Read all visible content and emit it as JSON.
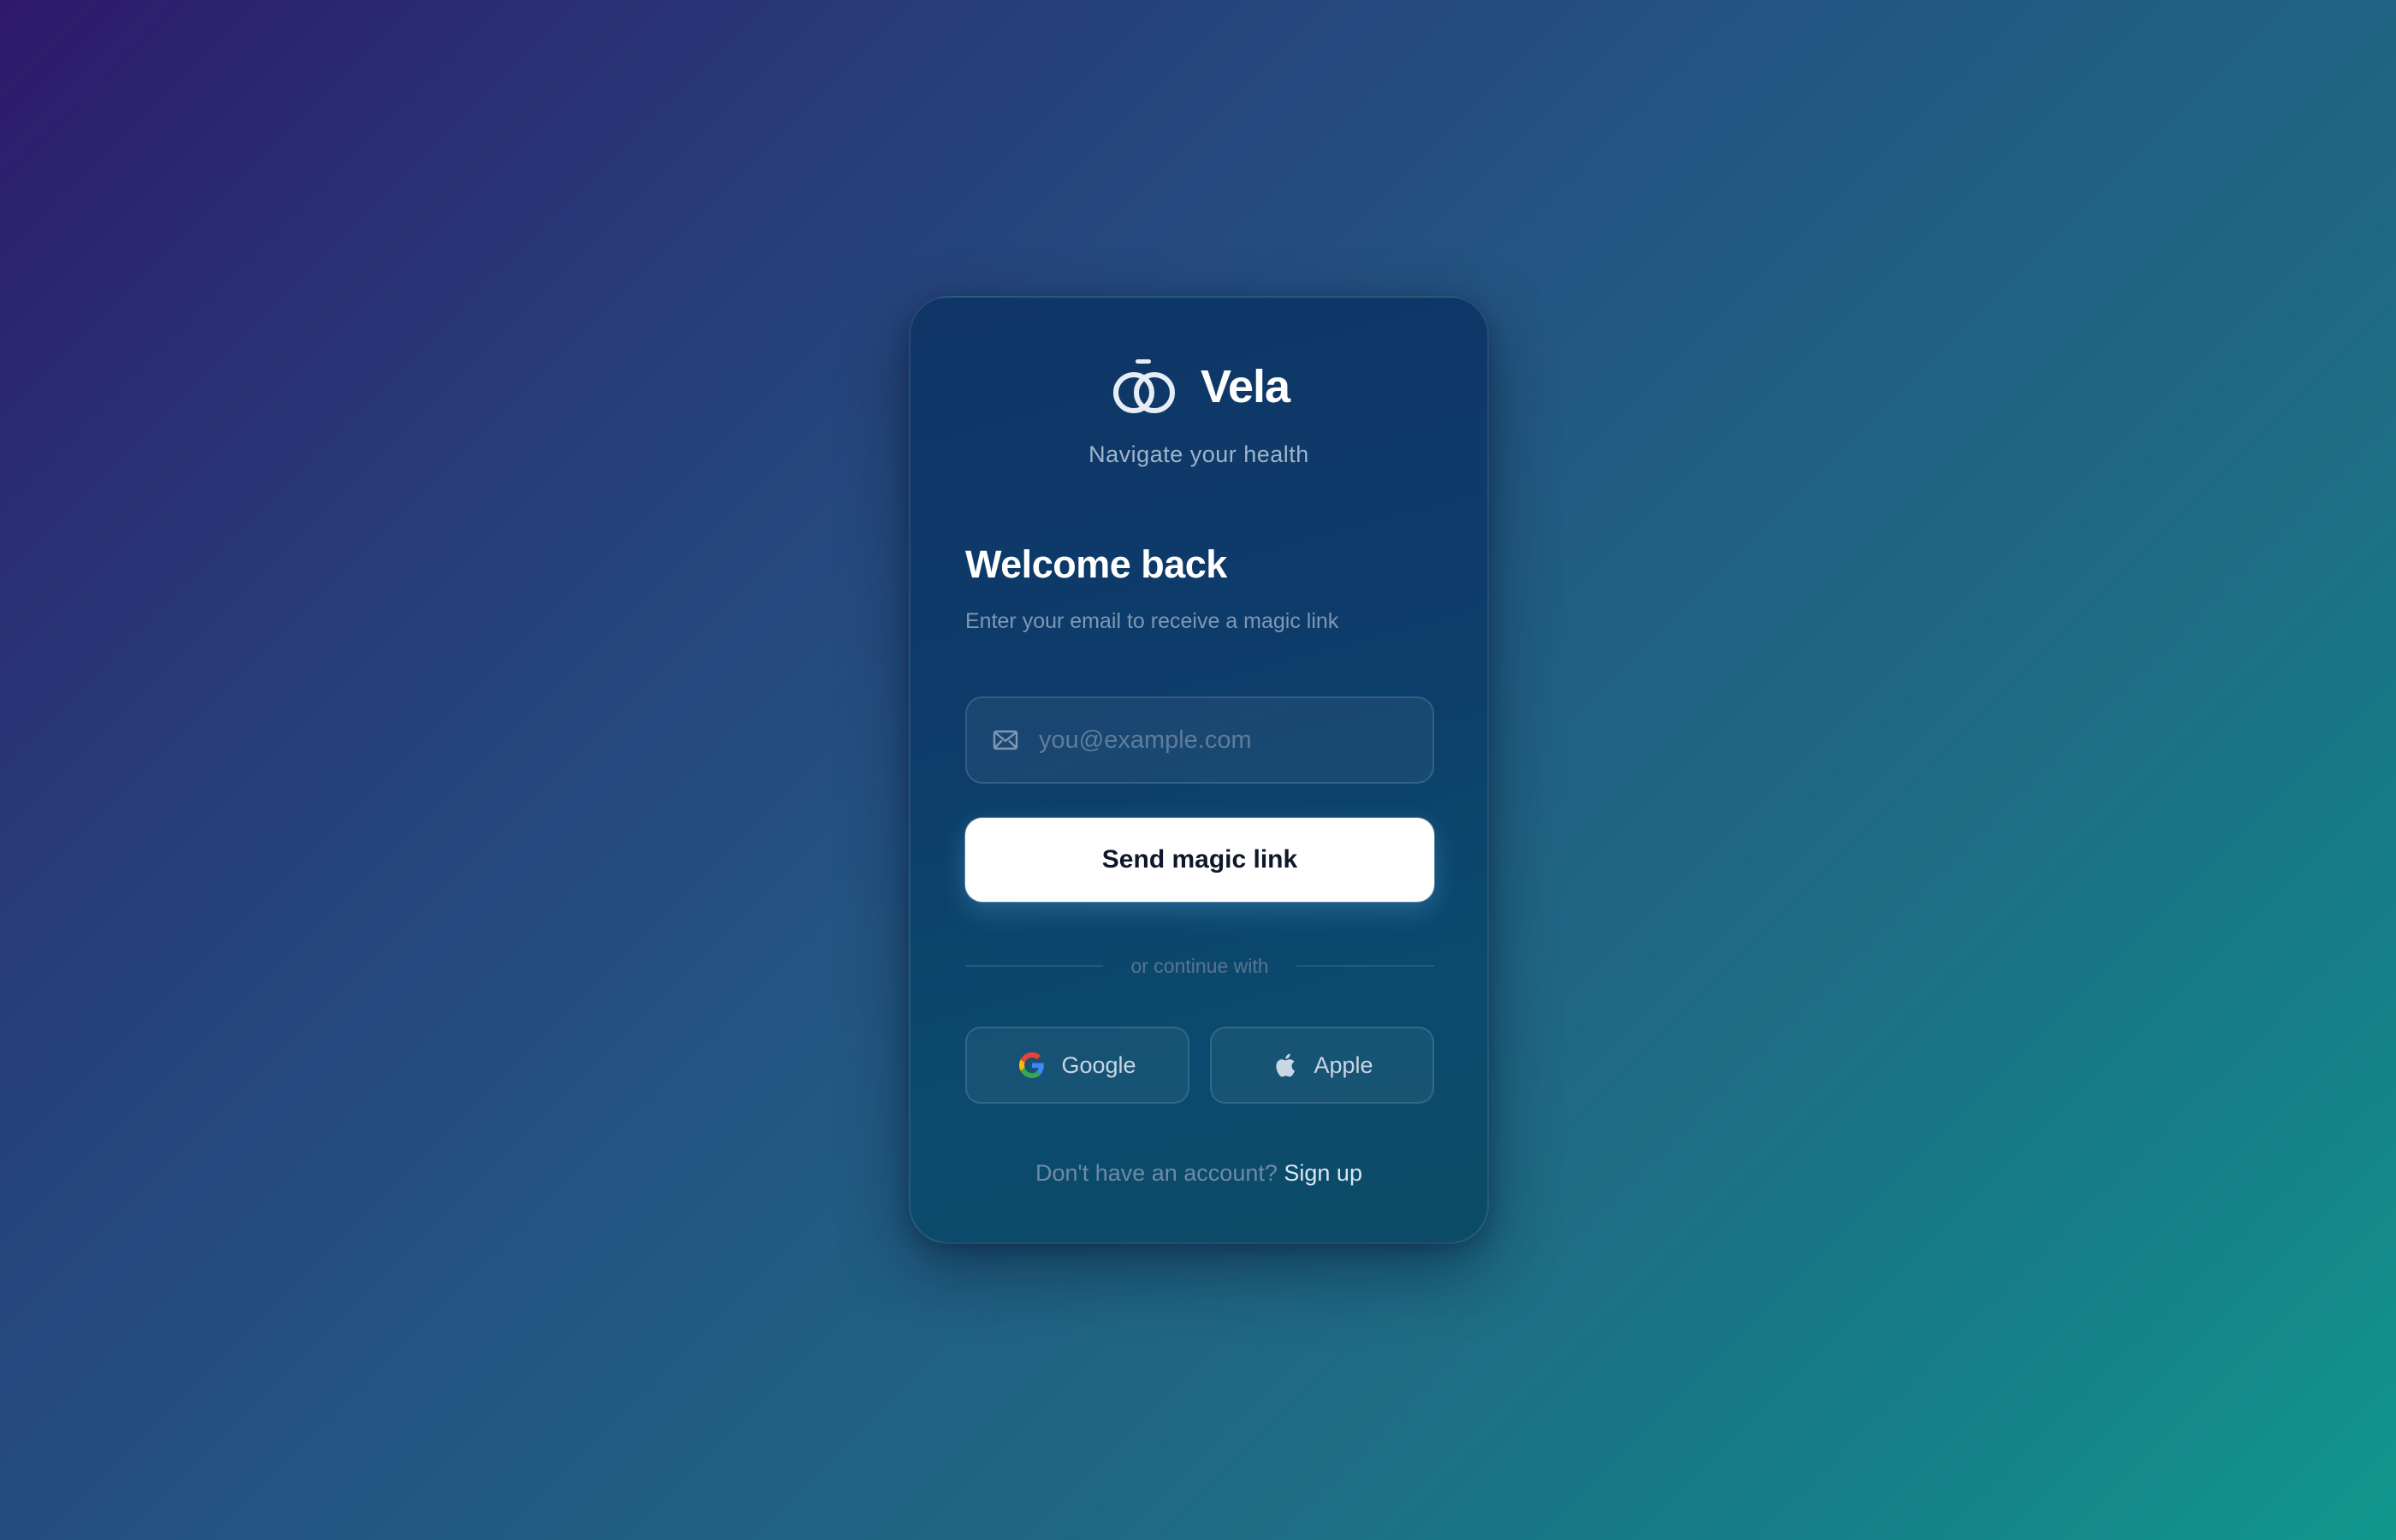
{
  "brand": {
    "name": "Vela",
    "tagline": "Navigate your health"
  },
  "login": {
    "heading": "Welcome back",
    "subheading": "Enter your email to receive a magic link",
    "email_placeholder": "you@example.com",
    "email_value": "",
    "submit_label": "Send magic link",
    "divider_text": "or continue with"
  },
  "social": [
    {
      "label": "Google",
      "icon": "google-icon"
    },
    {
      "label": "Apple",
      "icon": "apple-icon"
    }
  ],
  "footer": {
    "prompt": "Don't have an account?",
    "link_label": "Sign up"
  },
  "colors": {
    "background_start": "#2e1a6b",
    "background_end": "#12978c",
    "card": "#0d3c6a",
    "button": "#ffffff"
  }
}
